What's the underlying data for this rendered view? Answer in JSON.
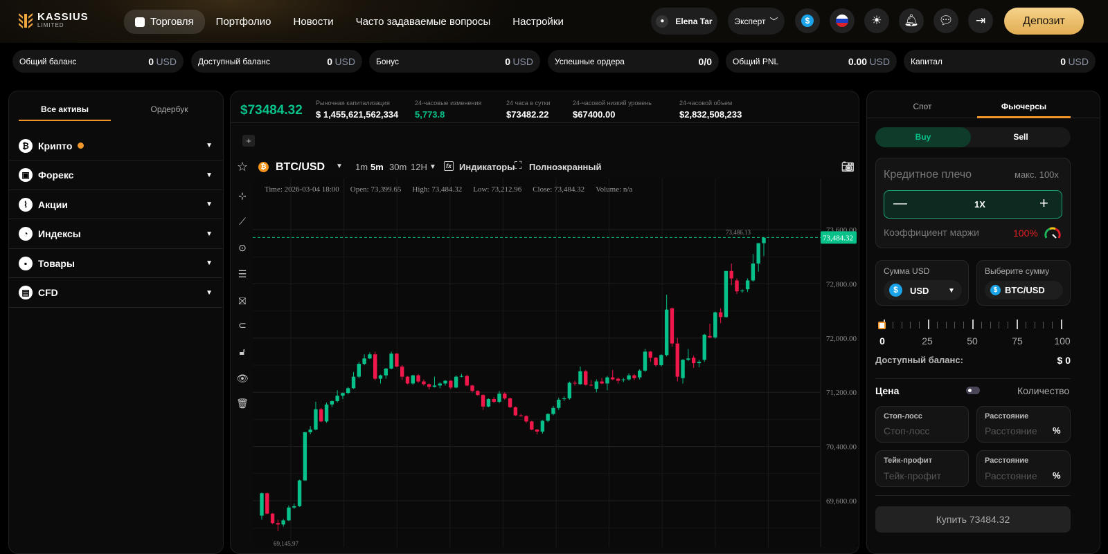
{
  "brand": {
    "name": "KASSIUS",
    "sub": "LIMITED"
  },
  "nav": [
    {
      "label": "Торговля",
      "active": true
    },
    {
      "label": "Портфолио"
    },
    {
      "label": "Новости"
    },
    {
      "label": "Часто задаваемые вопросы"
    },
    {
      "label": "Настройки"
    }
  ],
  "header": {
    "user": "Elena Tar",
    "mode": "Эксперт",
    "deposit": "Депозит",
    "icons": [
      "dollar-icon",
      "russia-flag-icon",
      "sun-icon",
      "bell-icon",
      "chat-icon",
      "logout-icon"
    ]
  },
  "stats": [
    {
      "label": "Общий баланс",
      "value": "0",
      "unit": "USD"
    },
    {
      "label": "Доступный баланс",
      "value": "0",
      "unit": "USD"
    },
    {
      "label": "Бонус",
      "value": "0",
      "unit": "USD"
    },
    {
      "label": "Успешные ордера",
      "value": "0/0",
      "unit": ""
    },
    {
      "label": "Общий PNL",
      "value": "0.00",
      "unit": "USD"
    },
    {
      "label": "Капитал",
      "value": "0",
      "unit": "USD"
    }
  ],
  "left": {
    "tabs": [
      "Все активы",
      "Ордербук"
    ],
    "categories": [
      "Крипто",
      "Форекс",
      "Акции",
      "Индексы",
      "Товары",
      "CFD"
    ]
  },
  "market": {
    "price": "$73484.32",
    "items": [
      {
        "label": "Рыночная капитализация",
        "value": "$ 1,455,621,562,334"
      },
      {
        "label": "24-часовые изменения",
        "value": "5,773.8"
      },
      {
        "label": "24 часа в сутки",
        "value": "$73482.22"
      },
      {
        "label": "24-часовой низкий уровень",
        "value": "$67400.00"
      },
      {
        "label": "24-часовой объем",
        "value": "$2,832,508,233"
      }
    ]
  },
  "toolbar": {
    "symbol": "BTC/USD",
    "intervals": [
      "1m",
      "5m",
      "30m",
      "12H"
    ],
    "active_interval": "5m",
    "indicators": "Индикаторы",
    "fullscreen": "Полноэкранный"
  },
  "colors": {
    "up": "#08c18a",
    "down": "#f0174a",
    "accent": "#f0962a"
  },
  "chart_data": {
    "type": "candlestick",
    "legend": {
      "time": "Time: 2026-03-04 18:00",
      "open": "Open: 73,399.65",
      "high": "High: 73,484.32",
      "low": "Low: 73,212.96",
      "close": "Close: 73,484.32",
      "volume": "Volume: n/a"
    },
    "y_ticks": [
      "73,600.00",
      "72,800.00",
      "72,000.00",
      "71,200.00",
      "70,400.00",
      "69,600.00"
    ],
    "ylim": [
      68900,
      73800
    ],
    "last_price_label": "73,484.32",
    "last_price": 73484.32,
    "high_marker": "73,486.13",
    "high_marker_value": 73486.13,
    "low_marker": "69,145.97",
    "ohlc": [
      [
        69380,
        69720,
        69320,
        69710
      ],
      [
        69710,
        69720,
        69400,
        69410
      ],
      [
        69410,
        69420,
        69260,
        69270
      ],
      [
        69270,
        69320,
        69150,
        69250
      ],
      [
        69250,
        69330,
        69220,
        69310
      ],
      [
        69310,
        69530,
        69300,
        69500
      ],
      [
        69500,
        69560,
        69480,
        69520
      ],
      [
        69520,
        69910,
        69510,
        69900
      ],
      [
        69900,
        70620,
        69890,
        70610
      ],
      [
        70610,
        70700,
        70580,
        70650
      ],
      [
        70650,
        71060,
        70640,
        70950
      ],
      [
        70950,
        70970,
        70760,
        70770
      ],
      [
        70770,
        71050,
        70750,
        71020
      ],
      [
        71020,
        71080,
        70980,
        71070
      ],
      [
        71070,
        71230,
        71050,
        71150
      ],
      [
        71150,
        71200,
        71100,
        71190
      ],
      [
        71190,
        71280,
        71170,
        71260
      ],
      [
        71260,
        71500,
        71250,
        71430
      ],
      [
        71430,
        71650,
        71410,
        71620
      ],
      [
        71620,
        71760,
        71600,
        71700
      ],
      [
        71700,
        71790,
        71690,
        71760
      ],
      [
        71760,
        71800,
        71380,
        71400
      ],
      [
        71400,
        71460,
        71330,
        71450
      ],
      [
        71450,
        71560,
        71400,
        71550
      ],
      [
        71550,
        71800,
        71540,
        71770
      ],
      [
        71770,
        71780,
        71570,
        71580
      ],
      [
        71580,
        71600,
        71380,
        71430
      ],
      [
        71430,
        71440,
        71320,
        71330
      ],
      [
        71330,
        71460,
        71310,
        71450
      ],
      [
        71450,
        71470,
        71340,
        71360
      ],
      [
        71360,
        71390,
        71300,
        71320
      ],
      [
        71320,
        71330,
        71240,
        71280
      ],
      [
        71280,
        71430,
        71270,
        71300
      ],
      [
        71300,
        71350,
        71260,
        71330
      ],
      [
        71330,
        71380,
        71300,
        71370
      ],
      [
        71370,
        71380,
        71250,
        71270
      ],
      [
        71270,
        71450,
        71260,
        71430
      ],
      [
        71430,
        71470,
        71420,
        71440
      ],
      [
        71440,
        71460,
        71290,
        71300
      ],
      [
        71300,
        71310,
        71200,
        71220
      ],
      [
        71220,
        71230,
        71150,
        71160
      ],
      [
        71160,
        71170,
        70940,
        70990
      ],
      [
        70990,
        71110,
        70980,
        71100
      ],
      [
        71100,
        71130,
        71040,
        71060
      ],
      [
        71060,
        71220,
        71040,
        71180
      ],
      [
        71180,
        71200,
        71090,
        71110
      ],
      [
        71110,
        71120,
        70970,
        70980
      ],
      [
        70980,
        70990,
        70850,
        70860
      ],
      [
        70860,
        70880,
        70840,
        70850
      ],
      [
        70850,
        70860,
        70750,
        70770
      ],
      [
        70770,
        70780,
        70640,
        70650
      ],
      [
        70650,
        70660,
        70580,
        70620
      ],
      [
        70620,
        70790,
        70590,
        70780
      ],
      [
        70780,
        70890,
        70760,
        70880
      ],
      [
        70880,
        71000,
        70860,
        70970
      ],
      [
        70970,
        71120,
        70940,
        71090
      ],
      [
        71100,
        71140,
        71070,
        71110
      ],
      [
        71110,
        71360,
        71090,
        71340
      ],
      [
        71340,
        71370,
        71300,
        71330
      ],
      [
        71320,
        71580,
        71310,
        71510
      ],
      [
        71510,
        71530,
        71300,
        71310
      ],
      [
        71310,
        71380,
        71290,
        71300
      ],
      [
        71250,
        71390,
        71200,
        71360
      ],
      [
        71360,
        71410,
        71320,
        71330
      ],
      [
        71330,
        71440,
        71230,
        71420
      ],
      [
        71420,
        71530,
        71380,
        71390
      ],
      [
        71400,
        71420,
        71330,
        71370
      ],
      [
        71380,
        71410,
        71350,
        71390
      ],
      [
        71390,
        71480,
        71370,
        71450
      ],
      [
        71450,
        71470,
        71380,
        71410
      ],
      [
        71420,
        71540,
        71390,
        71520
      ],
      [
        71520,
        71840,
        71500,
        71800
      ],
      [
        71800,
        71810,
        71650,
        71710
      ],
      [
        71710,
        71720,
        71580,
        71600
      ],
      [
        71600,
        71760,
        71580,
        71750
      ],
      [
        71750,
        72640,
        71730,
        72420
      ],
      [
        72440,
        72450,
        71870,
        71920
      ],
      [
        71920,
        72000,
        71360,
        71430
      ],
      [
        71410,
        71690,
        71330,
        71680
      ],
      [
        71680,
        71840,
        71660,
        71700
      ],
      [
        71710,
        71740,
        71560,
        71630
      ],
      [
        71630,
        71680,
        71570,
        71650
      ],
      [
        71680,
        72060,
        71650,
        72050
      ],
      [
        72030,
        72210,
        72000,
        72010
      ],
      [
        72010,
        72390,
        71990,
        72380
      ],
      [
        72380,
        72440,
        72220,
        72310
      ],
      [
        72310,
        72990,
        72300,
        72990
      ],
      [
        72990,
        73100,
        72780,
        72880
      ],
      [
        72850,
        72880,
        72650,
        72690
      ],
      [
        72690,
        72720,
        72670,
        72700
      ],
      [
        72720,
        72880,
        72680,
        72850
      ],
      [
        72850,
        73240,
        72830,
        73100
      ],
      [
        73100,
        73400,
        72980,
        73400
      ],
      [
        73400,
        73490,
        73210,
        73480
      ]
    ]
  },
  "right": {
    "tabs": [
      "Спот",
      "Фьючерсы"
    ],
    "active_tab": "Фьючерсы",
    "buy": "Buy",
    "sell": "Sell",
    "leverage": {
      "label": "Кредитное плечо",
      "max": "макс. 100x",
      "value": "1X",
      "margin_label": "Коэффициент маржи",
      "margin_value": "100%"
    },
    "amount": {
      "label": "Сумма USD",
      "currency": "USD",
      "pick_label": "Выберите сумму",
      "pair": "BTC/USD"
    },
    "slider": {
      "value": 0,
      "labels": [
        "0",
        "25",
        "50",
        "75",
        "100"
      ]
    },
    "available": {
      "label": "Доступный баланс:",
      "value": "$ 0"
    },
    "price_label": "Цена",
    "qty_label": "Количество",
    "stop_loss": {
      "label": "Стоп-лосс",
      "placeholder": "Стоп-лосс"
    },
    "sl_distance": {
      "label": "Расстояние",
      "placeholder": "Расстояние",
      "unit": "%"
    },
    "take_profit": {
      "label": "Тейк-профит",
      "placeholder": "Тейк-профит"
    },
    "tp_distance": {
      "label": "Расстояние",
      "placeholder": "Расстояние",
      "unit": "%"
    },
    "submit": "Купить 73484.32"
  }
}
